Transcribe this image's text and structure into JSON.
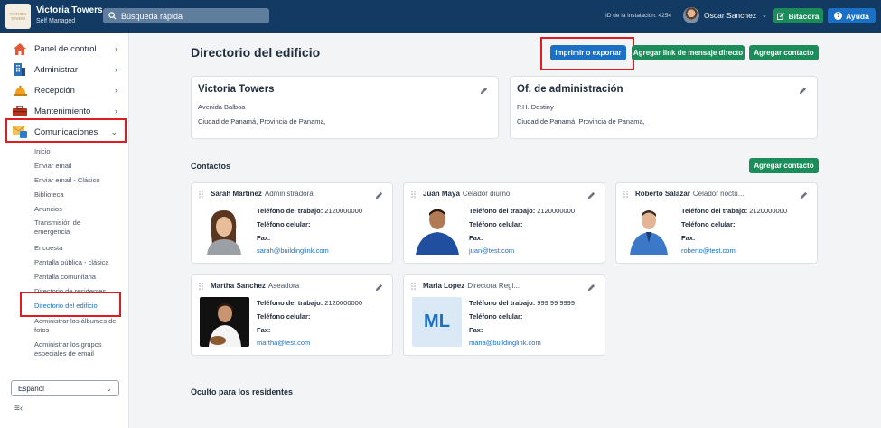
{
  "app": {
    "logo_text": "VICTORIA TOWERS",
    "title": "Victoria Towers",
    "subtitle": "Self Managed",
    "search_placeholder": "Búsqueda rápida",
    "install_id": "ID de la instalación: 4254",
    "user_name": "Oscar Sanchez",
    "bitacora_label": "Bitácora",
    "ayuda_label": "Ayuda"
  },
  "sidebar": {
    "items": [
      {
        "label": "Panel de control",
        "icon": "house-icon"
      },
      {
        "label": "Administrar",
        "icon": "building-icon"
      },
      {
        "label": "Recepción",
        "icon": "bell-icon"
      },
      {
        "label": "Mantenimiento",
        "icon": "toolbox-icon"
      },
      {
        "label": "Comunicaciones",
        "icon": "envelope-icon"
      }
    ],
    "sub_items": [
      "Inicio",
      "Enviar email",
      "Enviar email - Clásico",
      "Biblioteca",
      "Anuncios",
      "Transmisión de emergencia",
      "Encuesta",
      "Pantalla pública - clásica",
      "Pantalla comunitaria",
      "Directorio de residentes",
      "Directorio del edificio",
      "Administrar los álbumes de fotos",
      "Administrar los grupos especiales de email"
    ],
    "language": "Español"
  },
  "main": {
    "title": "Directorio del edificio",
    "btn_print": "Imprimir o exportar",
    "btn_link": "Agregar link de mensaje directo",
    "btn_add_contact": "Agregar contacto",
    "building_card": {
      "name": "Victoria Towers",
      "line1": "Avenida Balboa",
      "line2": "Ciudad de Panamá, Provincia de Panama,"
    },
    "admin_card": {
      "name": "Of. de administración",
      "line1": "P.H. Destiny",
      "line2": "Ciudad de Panamá, Provincia de Panama,"
    },
    "contacts_title": "Contactos",
    "contacts_add": "Agregar contacto",
    "labels": {
      "work_phone": "Teléfono del trabajo:",
      "cell_phone": "Teléfono celular:",
      "fax": "Fax:"
    },
    "contacts": [
      {
        "name": "Sarah Martinez",
        "role": "Administradora",
        "work_phone": "2120000000",
        "email": "sarah@buildinglink.com"
      },
      {
        "name": "Juan Maya",
        "role": "Celador diurno",
        "work_phone": "2120000000",
        "email": "juan@test.com"
      },
      {
        "name": "Roberto Salazar",
        "role": "Celador noctu...",
        "work_phone": "2120000000",
        "email": "roberto@test.com"
      },
      {
        "name": "Martha Sanchez",
        "role": "Aseadora",
        "work_phone": "2120000000",
        "email": "martha@test.com"
      },
      {
        "name": "Maria Lopez",
        "role": "Directora Regi...",
        "work_phone": "999 99 9999",
        "email": "maria@buildinglink.com",
        "initials": "ML"
      }
    ],
    "hidden_title": "Oculto para los residentes"
  }
}
